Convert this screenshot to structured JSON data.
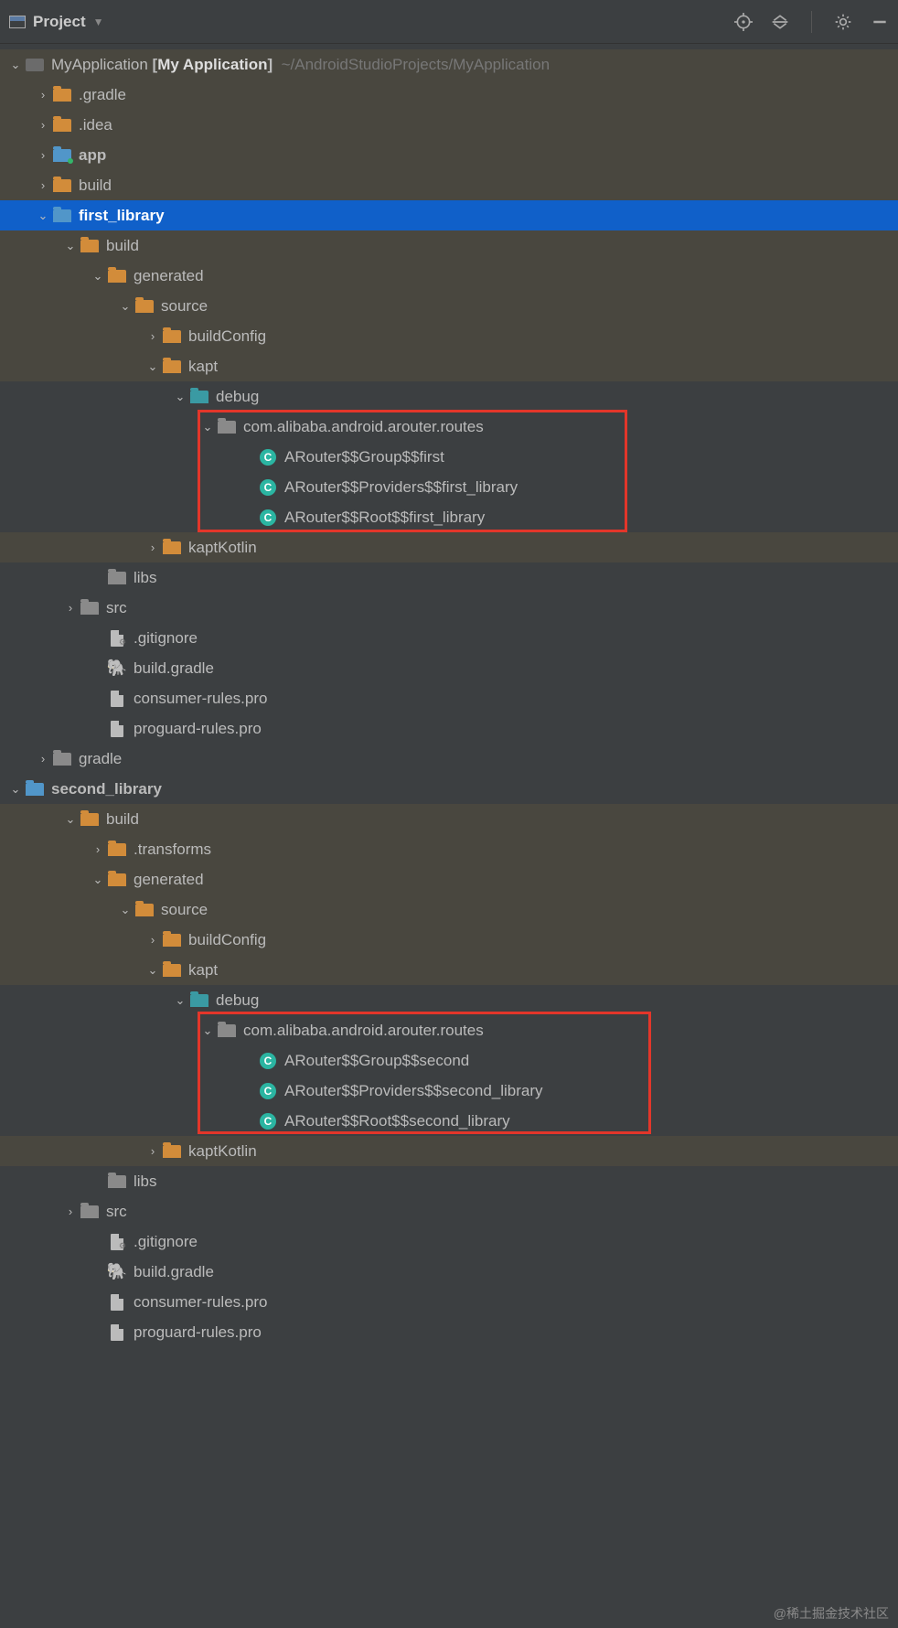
{
  "toolbar": {
    "title": "Project"
  },
  "root": {
    "name": "MyApplication",
    "display": "My Application",
    "path": "~/AndroidStudioProjects/MyApplication"
  },
  "tree": {
    "gradle_dir": ".gradle",
    "idea_dir": ".idea",
    "app": "app",
    "build": "build",
    "first_library": "first_library",
    "fl_build": "build",
    "fl_generated": "generated",
    "fl_source": "source",
    "fl_buildConfig": "buildConfig",
    "fl_kapt": "kapt",
    "fl_debug": "debug",
    "fl_pkg": "com.alibaba.android.arouter.routes",
    "fl_c1": "ARouter$$Group$$first",
    "fl_c2": "ARouter$$Providers$$first_library",
    "fl_c3": "ARouter$$Root$$first_library",
    "fl_kaptKotlin": "kaptKotlin",
    "fl_libs": "libs",
    "fl_src": "src",
    "fl_gitignore": ".gitignore",
    "fl_buildgradle": "build.gradle",
    "fl_consumer": "consumer-rules.pro",
    "fl_proguard": "proguard-rules.pro",
    "gradle2": "gradle",
    "second_library": "second_library",
    "sl_build": "build",
    "sl_transforms": ".transforms",
    "sl_generated": "generated",
    "sl_source": "source",
    "sl_buildConfig": "buildConfig",
    "sl_kapt": "kapt",
    "sl_debug": "debug",
    "sl_pkg": "com.alibaba.android.arouter.routes",
    "sl_c1": "ARouter$$Group$$second",
    "sl_c2": "ARouter$$Providers$$second_library",
    "sl_c3": "ARouter$$Root$$second_library",
    "sl_kaptKotlin": "kaptKotlin",
    "sl_libs": "libs",
    "sl_src": "src",
    "sl_gitignore": ".gitignore",
    "sl_buildgradle": "build.gradle",
    "sl_consumer": "consumer-rules.pro",
    "sl_proguard": "proguard-rules.pro"
  },
  "watermark": "@稀土掘金技术社区"
}
